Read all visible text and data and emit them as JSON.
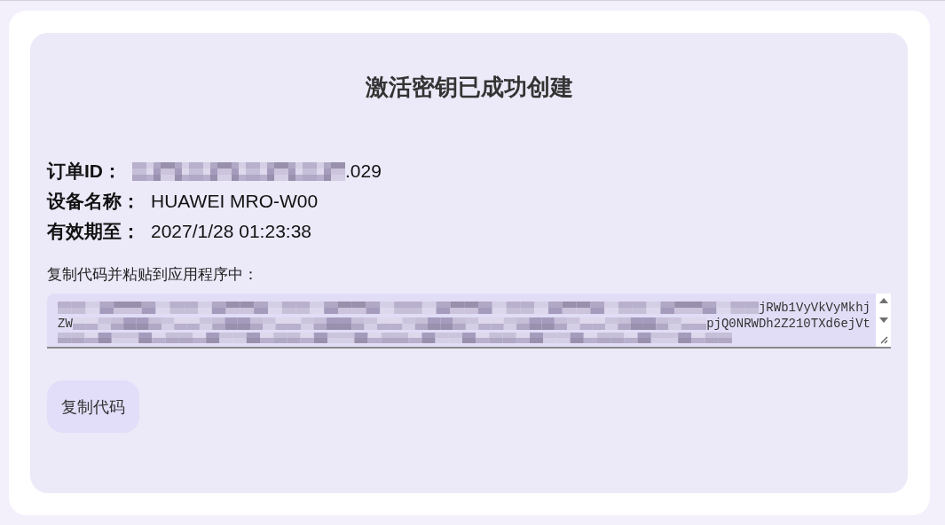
{
  "title": "激活密钥已成功创建",
  "details": [
    {
      "label": "订单ID：",
      "value": ".029",
      "redacted": true
    },
    {
      "label": "设备名称：",
      "value": "HUAWEI MRO-W00",
      "redacted": false
    },
    {
      "label": "有效期至：",
      "value": "2027/1/28 01:23:38",
      "redacted": false
    }
  ],
  "instruction": "复制代码并粘贴到应用程序中：",
  "code_lines": [
    {
      "end": "jRWb1VyVkVyMkhj"
    },
    {
      "start": "ZW",
      "end": "pjQ0NRWDh2Z210TXd6ejVt"
    }
  ],
  "copy_button": "复制代码"
}
